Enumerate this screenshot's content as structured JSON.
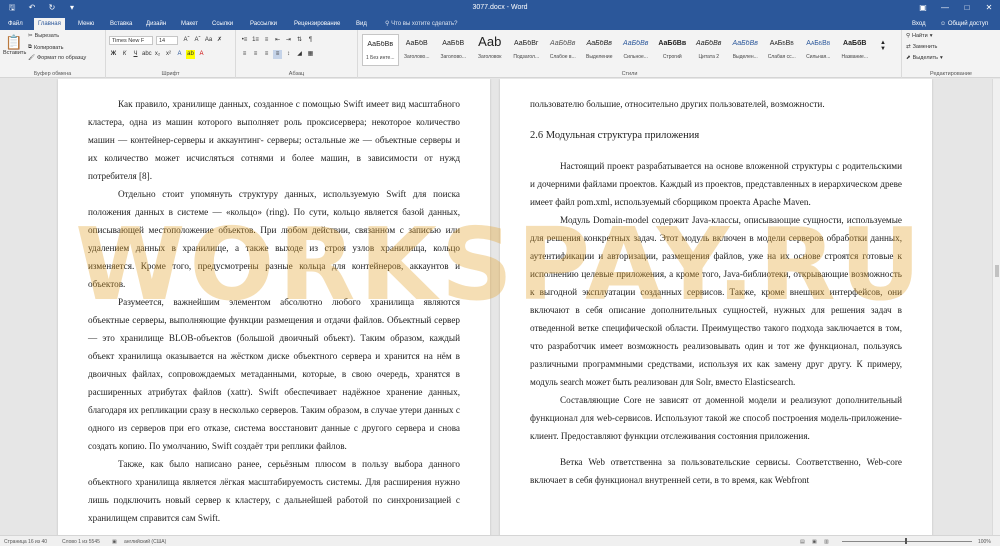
{
  "title_bar": {
    "title": "3077.docx - Word",
    "signin": "Вход",
    "save_icon": "save-icon",
    "undo_icon": "undo-icon",
    "redo_icon": "redo-icon"
  },
  "tabs": [
    {
      "label": "Файл"
    },
    {
      "label": "Главная"
    },
    {
      "label": "Меню"
    },
    {
      "label": "Вставка"
    },
    {
      "label": "Дизайн"
    },
    {
      "label": "Макет"
    },
    {
      "label": "Ссылки"
    },
    {
      "label": "Рассылки"
    },
    {
      "label": "Рецензирование"
    },
    {
      "label": "Вид"
    }
  ],
  "tell_me": "Что вы хотите сделать?",
  "share": "Общий доступ",
  "ribbon": {
    "clipboard": {
      "paste": "Вставить",
      "cut": "Вырезать",
      "copy": "Копировать",
      "format_painter": "Формат по образцу",
      "label": "Буфер обмена"
    },
    "font": {
      "name": "Times New F",
      "size": "14",
      "label": "Шрифт"
    },
    "paragraph": {
      "label": "Абзац"
    },
    "styles": {
      "label": "Стили",
      "items": [
        {
          "preview": "АаБбВв",
          "name": "1 Без инте..."
        },
        {
          "preview": "АаБбВ",
          "name": "Заголово..."
        },
        {
          "preview": "АаБбВ",
          "name": "Заголово..."
        },
        {
          "preview": "Aab",
          "name": "Заголовок"
        },
        {
          "preview": "АаБбВг",
          "name": "Подзагол..."
        },
        {
          "preview": "АаБбВв",
          "name": "Слабое в..."
        },
        {
          "preview": "АаБбВв",
          "name": "Выделение"
        },
        {
          "preview": "АаБбВв",
          "name": "Сильное..."
        },
        {
          "preview": "АаБбВв",
          "name": "Строгий"
        },
        {
          "preview": "АаБбВв",
          "name": "Цитата 2"
        },
        {
          "preview": "АаБбВв",
          "name": "Выделен..."
        },
        {
          "preview": "АаБбВв",
          "name": "Слабая сс..."
        },
        {
          "preview": "АаБбВв",
          "name": "Сильная..."
        },
        {
          "preview": "АаБбВ",
          "name": "Название..."
        }
      ]
    },
    "editing": {
      "find": "Найти",
      "replace": "Заменить",
      "select": "Выделить",
      "label": "Редактирование"
    }
  },
  "left_page": {
    "paragraphs": [
      "Как правило, хранилище данных, созданное с помощью Swift имеет вид масштабного кластера, одна из машин которого выполняет роль проксисервера; некоторое количество машин — контейнер-серверы и аккаунтинг- серверы; остальные же — объектные серверы и их количество может исчисляться сотнями и более машин, в зависимости от нужд потребителя [8].",
      "Отдельно стоит упомянуть структуру данных, используемую Swift для поиска положения данных в системе — «кольцо» (ring). По сути, кольцо является базой данных, описывающей местоположение объектов. При любом действии, связанном с записью или удалением данных в хранилище, а также выходе из строя узлов хранилища, кольцо изменяется. Кроме того, предусмотрены разные кольца для контейнеров, аккаунтов и объектов.",
      "Разумеется, важнейшим элементом абсолютно любого хранилища являются объектные серверы, выполняющие функции размещения и отдачи файлов. Объектный сервер — это хранилище BLOB-объектов (большой двоичный объект). Таким образом, каждый объект хранилища оказывается на жёстком диске объектного сервера и хранится на нём в двоичных файлах, сопровождаемых метаданными, которые, в свою очередь, хранятся в расширенных атрибутах файлов (xattr). Swift обеспечивает надёжное хранение данных, благодаря их репликации сразу в несколько серверов. Таким образом, в случае утери данных с одного из серверов при его отказе, система восстановит данные с другого сервера и снова создать копию. По умолчанию, Swift создаёт три реплики файлов.",
      "Также, как было написано ранее, серьёзным плюсом в пользу выбора данного объектного хранилища является лёгкая масштабируемость системы. Для расширения нужно лишь подключить новый сервер к кластеру, с дальнейшей работой по синхронизацией с хранилищем справится сам Swift."
    ]
  },
  "right_page": {
    "lead": "пользователю большие, относительно других пользователей, возможности.",
    "heading": "2.6 Модульная структура приложения",
    "paragraphs": [
      "Настоящий проект разрабатывается на основе вложенной структуры с родительскими и дочерними файлами проектов. Каждый из проектов, представленных в иерархическом древе имеет файл pom.xml, используемый сборщиком проекта Apache Maven.",
      "Модуль Domain-model содержит Java-классы, описывающие сущности, используемые для решения конкретных задач. Этот модуль включен в модели серверов обработки данных, аутентификации и авторизации, размещения файлов, уже на их основе строятся готовые к исполнению целевые приложения, а кроме того, Java-библиотеки, открывающие возможность к выгодной эксплуатации созданных сервисов. Также, кроме внешних интерфейсов, они включают в себя описание дополнительных сущностей, нужных для решения задач в отведенной ветке специфической области. Преимущество такого подхода заключается в том, что разработчик имеет возможность реализовывать один и тот же функционал, пользуясь различными программными средствами, используя их как замену друг другу. К примеру, модуль search может быть реализован для Solr, вместо Elasticsearch.",
      "Составляющие Core не зависят от доменной модели и реализуют дополнительный функционал для web-сервисов. Используют такой же способ построения модель-приложение-клиент. Предоставляют функции отслеживания состояния приложения.",
      "Ветка Web ответственна за пользовательские сервисы. Соответственно, Web-core включает в себя функционал внутренней сети, в то время, как Webfront"
    ]
  },
  "watermark": "WORKSPAY.RU",
  "status": {
    "page": "Страница 16 из 40",
    "words": "Слово 1 из 5545",
    "language": "английский (США)",
    "zoom": "100%"
  }
}
